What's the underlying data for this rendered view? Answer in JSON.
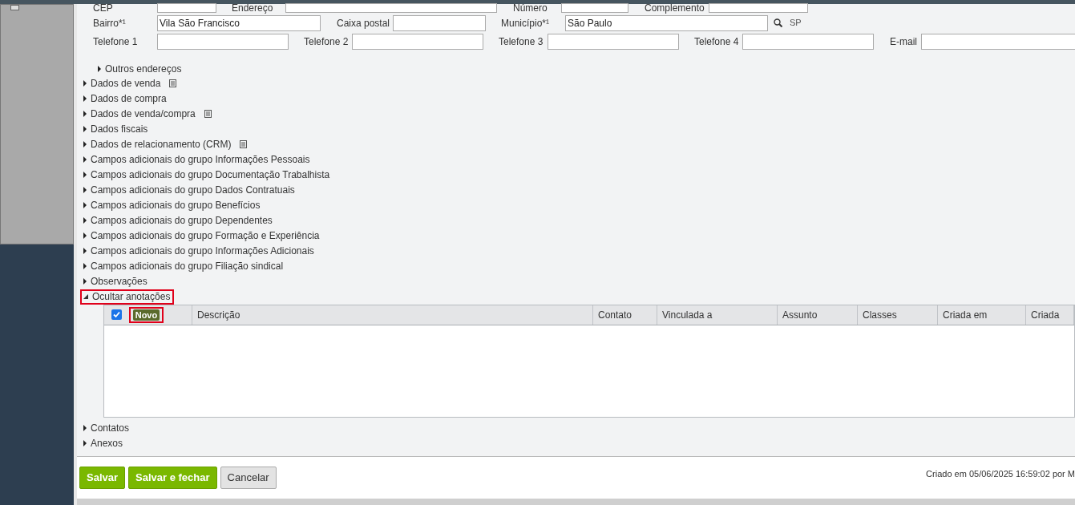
{
  "side_panel": {
    "checked": false
  },
  "form": {
    "rows": [
      [
        {
          "label": "CEP",
          "kind": "text"
        },
        {
          "label": "Endereço",
          "kind": "text"
        },
        {
          "label": "Número",
          "kind": "text"
        },
        {
          "label": "Complemento",
          "kind": "text"
        }
      ],
      [
        {
          "label": "Bairro*¹",
          "value": "Vila São Francisco",
          "kind": "text"
        },
        {
          "label": "Caixa postal",
          "kind": "text"
        },
        {
          "label": "Município*¹",
          "value": "São Paulo",
          "kind": "lookup",
          "suffix": "SP"
        }
      ],
      [
        {
          "label": "Telefone 1",
          "kind": "text"
        },
        {
          "label": "Telefone 2",
          "kind": "text"
        },
        {
          "label": "Telefone 3",
          "kind": "text"
        },
        {
          "label": "Telefone 4",
          "kind": "text"
        },
        {
          "label": "E-mail",
          "kind": "text"
        }
      ]
    ],
    "subsections": [
      {
        "label": "Outros endereços",
        "expanded": false
      }
    ]
  },
  "sections": [
    {
      "label": "Dados de venda",
      "expanded": false,
      "has_note": true,
      "highlighted": false
    },
    {
      "label": "Dados de compra",
      "expanded": false,
      "has_note": false,
      "highlighted": false
    },
    {
      "label": "Dados de venda/compra",
      "expanded": false,
      "has_note": true,
      "highlighted": false
    },
    {
      "label": "Dados fiscais",
      "expanded": false,
      "has_note": false,
      "highlighted": false
    },
    {
      "label": "Dados de relacionamento (CRM)",
      "expanded": false,
      "has_note": true,
      "highlighted": false
    },
    {
      "label": "Campos adicionais do grupo Informações Pessoais",
      "expanded": false,
      "has_note": false,
      "highlighted": false
    },
    {
      "label": "Campos adicionais do grupo Documentação Trabalhista",
      "expanded": false,
      "has_note": false,
      "highlighted": false
    },
    {
      "label": "Campos adicionais do grupo Dados Contratuais",
      "expanded": false,
      "has_note": false,
      "highlighted": false
    },
    {
      "label": "Campos adicionais do grupo Benefícios",
      "expanded": false,
      "has_note": false,
      "highlighted": false
    },
    {
      "label": "Campos adicionais do grupo Dependentes",
      "expanded": false,
      "has_note": false,
      "highlighted": false
    },
    {
      "label": "Campos adicionais do grupo Formação e Experiência",
      "expanded": false,
      "has_note": false,
      "highlighted": false
    },
    {
      "label": "Campos adicionais do grupo Informações Adicionais",
      "expanded": false,
      "has_note": false,
      "highlighted": false
    },
    {
      "label": "Campos adicionais do grupo Filiação sindical",
      "expanded": false,
      "has_note": false,
      "highlighted": false
    },
    {
      "label": "Observações",
      "expanded": false,
      "has_note": false,
      "highlighted": false
    },
    {
      "label": "Ocultar anotações",
      "expanded": true,
      "has_note": false,
      "highlighted": true,
      "table": {
        "select_all": {
          "checked": true
        },
        "new_button": {
          "label": "Novo",
          "highlighted": true
        },
        "columns": [
          "Descrição",
          "Contato",
          "Vinculada a",
          "Assunto",
          "Classes",
          "Criada em",
          "Criada"
        ]
      }
    },
    {
      "label": "Contatos",
      "expanded": false,
      "has_note": false,
      "highlighted": false
    },
    {
      "label": "Anexos",
      "expanded": false,
      "has_note": false,
      "highlighted": false
    }
  ],
  "footer": {
    "buttons": [
      {
        "label": "Salvar",
        "kind": "primary"
      },
      {
        "label": "Salvar e fechar",
        "kind": "primary"
      },
      {
        "label": "Cancelar",
        "kind": "secondary"
      }
    ],
    "created": "Criado em 05/06/2025 16:59:02 por M"
  }
}
